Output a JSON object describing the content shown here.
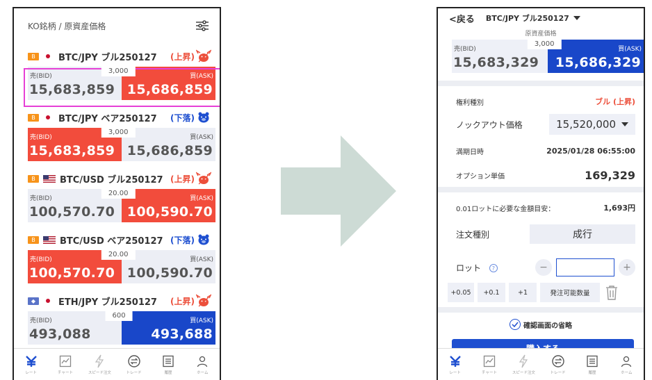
{
  "left_screen": {
    "header_title": "KO銘柄 / 原資産価格",
    "instruments": [
      {
        "coin": "B",
        "coin_type": "btc",
        "flag": "jp",
        "name": "BTC/JPY ブル250127",
        "direction": "(上昇)",
        "trend": "up",
        "spread": "3,000",
        "bid_label": "売(BID)",
        "bid": "15,683,859",
        "ask_label": "買(ASK)",
        "ask": "15,686,859",
        "bid_color": "grey",
        "ask_color": "red"
      },
      {
        "coin": "B",
        "coin_type": "btc",
        "flag": "jp",
        "name": "BTC/JPY ベア250127",
        "direction": "(下落)",
        "trend": "down",
        "spread": "3,000",
        "bid_label": "売(BID)",
        "bid": "15,683,859",
        "ask_label": "買(ASK)",
        "ask": "15,686,859",
        "bid_color": "red",
        "ask_color": "grey"
      },
      {
        "coin": "B",
        "coin_type": "btc",
        "flag": "us",
        "name": "BTC/USD ブル250127",
        "direction": "(上昇)",
        "trend": "up",
        "spread": "20.00",
        "bid_label": "売(BID)",
        "bid": "100,570.70",
        "ask_label": "買(ASK)",
        "ask": "100,590.70",
        "bid_color": "grey",
        "ask_color": "red"
      },
      {
        "coin": "B",
        "coin_type": "btc",
        "flag": "us",
        "name": "BTC/USD ベア250127",
        "direction": "(下落)",
        "trend": "down",
        "spread": "20.00",
        "bid_label": "売(BID)",
        "bid": "100,570.70",
        "ask_label": "買(ASK)",
        "ask": "100,590.70",
        "bid_color": "red",
        "ask_color": "grey"
      },
      {
        "coin": "◆",
        "coin_type": "eth",
        "flag": "jp",
        "name": "ETH/JPY ブル250127",
        "direction": "(上昇)",
        "trend": "up",
        "spread": "600",
        "bid_label": "売(BID)",
        "bid": "493,088",
        "ask_label": "買(ASK)",
        "ask": "493,688",
        "bid_color": "grey",
        "ask_color": "blue"
      }
    ]
  },
  "tabbar": [
    {
      "icon": "yen-rate-icon",
      "label": "レート",
      "active": true
    },
    {
      "icon": "chart-icon",
      "label": "チャート",
      "active": false
    },
    {
      "icon": "lightning-icon",
      "label": "スピード注文",
      "active": false
    },
    {
      "icon": "trade-icon",
      "label": "トレード",
      "active": false
    },
    {
      "icon": "history-icon",
      "label": "履歴",
      "active": false
    },
    {
      "icon": "home-icon",
      "label": "ホーム",
      "active": false
    }
  ],
  "right_screen": {
    "back_label": "<戻る",
    "title": "BTC/JPY ブル250127",
    "subtitle": "原資産価格",
    "spread": "3,000",
    "bid_label": "売(BID)",
    "bid": "15,683,329",
    "ask_label": "買(ASK)",
    "ask": "15,686,329",
    "rights_type_label": "権利種別",
    "rights_type_value": "ブル (上昇)",
    "knockout_label": "ノックアウト価格",
    "knockout_value": "15,520,000",
    "expiry_label": "満期日時",
    "expiry_value": "2025/01/28 06:55:00",
    "option_unit_label": "オプション単価",
    "option_unit_value": "169,329",
    "required_label": "0.01ロットに必要な金額目安：",
    "required_value": "1,693円",
    "order_type_label": "注文種別",
    "order_type_value": "成行",
    "lot_label": "ロット",
    "help_glyph": "?",
    "lot_value": "",
    "minus_glyph": "−",
    "plus_glyph": "+",
    "chips": [
      "+0.05",
      "+0.1",
      "+1",
      "発注可能数量"
    ],
    "confirm_skip_label": "確認画面の省略",
    "buy_button_label": "購入する"
  },
  "colors": {
    "red": "#f24c3c",
    "blue": "#1947c9",
    "grey_box": "#eceef5",
    "highlight": "#e640d6",
    "arrow": "#cddbd5"
  }
}
